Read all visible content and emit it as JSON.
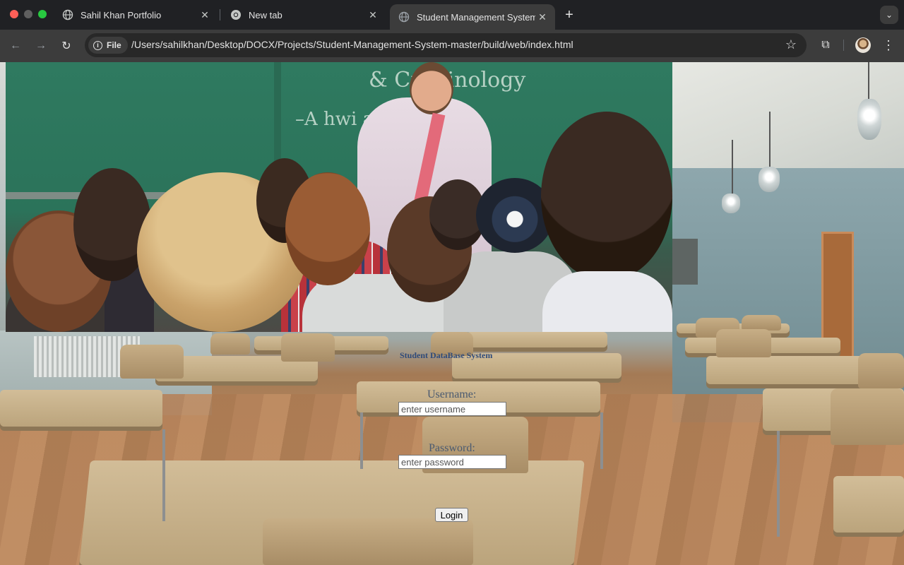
{
  "browser": {
    "tabs": [
      {
        "title": "Sahil Khan Portfolio",
        "icon": "globe-icon",
        "active": false
      },
      {
        "title": "New tab",
        "icon": "chrome-icon",
        "active": false
      },
      {
        "title": "Student Management System",
        "icon": "globe-icon",
        "active": true
      }
    ],
    "new_tab_glyph": "+",
    "tab_close_glyph": "✕",
    "chip_label": "File",
    "url": "/Users/sahilkhan/Desktop/DOCX/Projects/Student-Management-System-master/build/web/index.html",
    "icons": {
      "back": "←",
      "forward": "→",
      "reload": "↻",
      "star": "☆",
      "extensions": "⧉",
      "menu": "⋮",
      "tab_search": "⌄",
      "info": "i"
    }
  },
  "page": {
    "form_title": "Student DataBase System",
    "username_label": "Username:",
    "username_placeholder": "enter username",
    "password_label": "Password:",
    "password_placeholder": "enter password",
    "login_label": "Login"
  },
  "board_text": {
    "line1": "& Criminology",
    "line2": "–A   hwi         ate  mis        sous"
  },
  "colors": {
    "chrome_bg": "#202124",
    "toolbar_bg": "#3c3c3c",
    "omnibox_bg": "#282828",
    "title_color": "#2f4b7a"
  }
}
